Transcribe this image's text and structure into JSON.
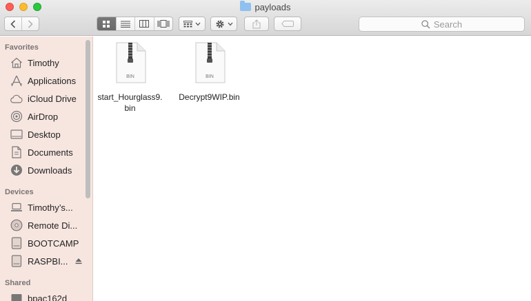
{
  "window": {
    "title": "payloads"
  },
  "toolbar": {
    "search_placeholder": "Search"
  },
  "sidebar": {
    "favorites_label": "Favorites",
    "favorites": [
      {
        "label": "Timothy",
        "icon": "home-icon"
      },
      {
        "label": "Applications",
        "icon": "applications-icon"
      },
      {
        "label": "iCloud Drive",
        "icon": "cloud-icon"
      },
      {
        "label": "AirDrop",
        "icon": "airdrop-icon"
      },
      {
        "label": "Desktop",
        "icon": "desktop-icon"
      },
      {
        "label": "Documents",
        "icon": "documents-icon"
      },
      {
        "label": "Downloads",
        "icon": "downloads-icon"
      }
    ],
    "devices_label": "Devices",
    "devices": [
      {
        "label": "Timothy’s...",
        "icon": "laptop-icon"
      },
      {
        "label": "Remote Di...",
        "icon": "disc-icon"
      },
      {
        "label": "BOOTCAMP",
        "icon": "drive-icon"
      },
      {
        "label": "RASPBI...",
        "icon": "drive-icon"
      }
    ],
    "shared_label": "Shared",
    "shared": [
      {
        "label": "bpac162d",
        "icon": "computer-icon"
      }
    ]
  },
  "files": [
    {
      "name": "start_Hourglass9.\nbin",
      "type_label": "BIN"
    },
    {
      "name": "Decrypt9WIP.bin",
      "type_label": "BIN"
    }
  ],
  "colors": {
    "sidebar_bg": "#f7e6e0",
    "folder_blue": "#8ec1ef"
  }
}
